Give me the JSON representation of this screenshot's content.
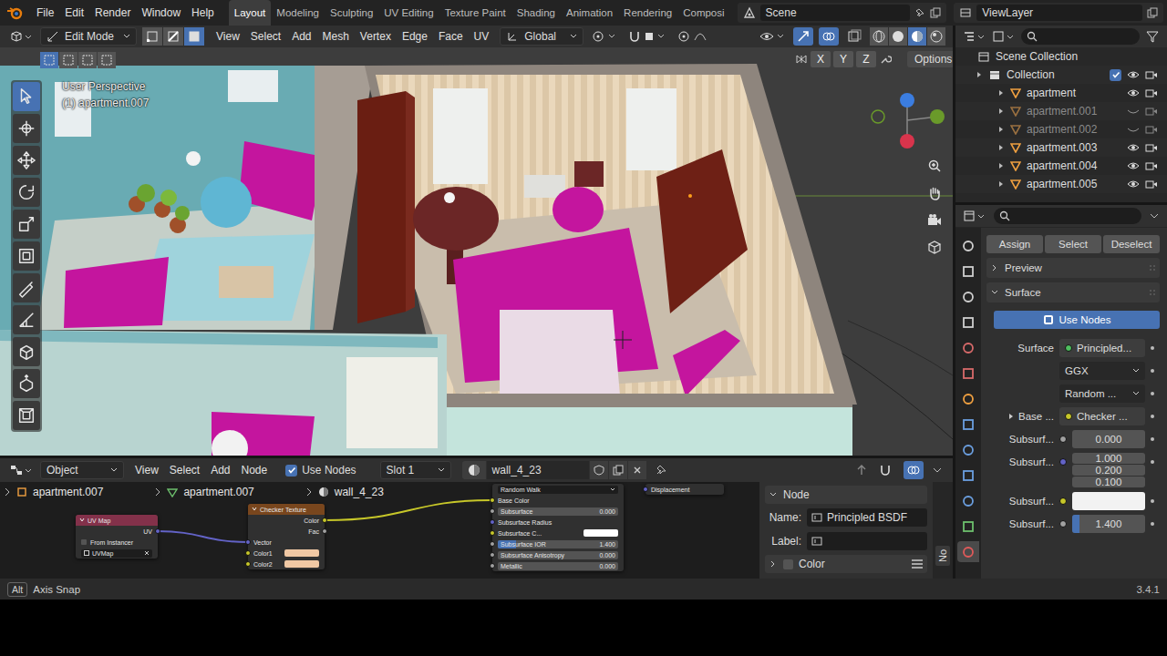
{
  "topbar": {
    "menus": [
      "File",
      "Edit",
      "Render",
      "Window",
      "Help"
    ],
    "workspaces": [
      {
        "label": "Layout",
        "selected": true
      },
      {
        "label": "Modeling",
        "selected": false
      },
      {
        "label": "Sculpting",
        "selected": false
      },
      {
        "label": "UV Editing",
        "selected": false
      },
      {
        "label": "Texture Paint",
        "selected": false
      },
      {
        "label": "Shading",
        "selected": false
      },
      {
        "label": "Animation",
        "selected": false
      },
      {
        "label": "Rendering",
        "selected": false
      },
      {
        "label": "Composi",
        "selected": false
      }
    ],
    "scene": "Scene",
    "view_layer": "ViewLayer"
  },
  "viewport_header": {
    "mode": "Edit Mode",
    "select_modes": [
      {
        "selected": false
      },
      {
        "selected": false
      },
      {
        "selected": true
      }
    ],
    "menus": [
      "View",
      "Select",
      "Add",
      "Mesh",
      "Vertex",
      "Edge",
      "Face",
      "UV"
    ],
    "orientation": "Global",
    "axes": [
      {
        "label": "X",
        "selected": false
      },
      {
        "label": "Y",
        "selected": false
      },
      {
        "label": "Z",
        "selected": false
      }
    ],
    "options": "Options"
  },
  "viewport": {
    "view_name": "User Perspective",
    "object_label": "(1) apartment.007",
    "box_modes": [
      {
        "selected": true
      },
      {
        "selected": false
      },
      {
        "selected": false
      },
      {
        "selected": false
      }
    ],
    "tools": [
      {
        "selected": true
      },
      {
        "selected": false
      },
      {
        "selected": false
      },
      {
        "selected": false
      },
      {
        "selected": false
      },
      {
        "selected": false
      },
      {
        "selected": false
      },
      {
        "selected": false
      },
      {
        "selected": false
      },
      {
        "selected": false
      },
      {
        "selected": false
      }
    ]
  },
  "outliner": {
    "root": "Scene Collection",
    "collection": {
      "label": "Collection",
      "checked": true
    },
    "items": [
      {
        "label": "apartment",
        "visible": true
      },
      {
        "label": "apartment.001",
        "visible": false
      },
      {
        "label": "apartment.002",
        "visible": false
      },
      {
        "label": "apartment.003",
        "visible": true
      },
      {
        "label": "apartment.004",
        "visible": true
      },
      {
        "label": "apartment.005",
        "visible": true
      }
    ]
  },
  "properties": {
    "tabs": [
      {
        "selected": false
      },
      {
        "selected": false
      },
      {
        "selected": false
      },
      {
        "selected": false
      },
      {
        "selected": false
      },
      {
        "selected": false
      },
      {
        "selected": false
      },
      {
        "selected": false
      },
      {
        "selected": false
      },
      {
        "selected": false
      },
      {
        "selected": false
      },
      {
        "selected": false
      },
      {
        "selected": true
      }
    ],
    "buttons": [
      "Assign",
      "Select",
      "Deselect"
    ],
    "panels": [
      {
        "label": "Preview",
        "expanded": false
      },
      {
        "label": "Surface",
        "expanded": true
      }
    ],
    "use_nodes": {
      "label": "Use Nodes",
      "on": true
    },
    "rows": [
      {
        "kind": "link",
        "label": "Surface",
        "value": "Principled...",
        "color": "#4fbf5f"
      },
      {
        "kind": "dropdown",
        "value": "GGX"
      },
      {
        "kind": "dropdown",
        "value": "Random ..."
      },
      {
        "kind": "link",
        "label": "Base ...",
        "value": "Checker ...",
        "color": "#c7c729",
        "expanded": false
      },
      {
        "kind": "number",
        "label": "Subsurf...",
        "value": "0.000",
        "color": "#a1a1a1",
        "level": 0
      },
      {
        "kind": "vector",
        "label": "Subsurf...",
        "values": [
          "1.000",
          "0.200",
          "0.100"
        ],
        "color": "#6363c7"
      },
      {
        "kind": "color",
        "label": "Subsurf...",
        "color": "#c7c729",
        "swatch": "#f2f2f2"
      },
      {
        "kind": "number",
        "label": "Subsurf...",
        "value": "1.400",
        "color": "#a1a1a1",
        "level": 0.1
      }
    ]
  },
  "node_editor": {
    "editor_type": "Object",
    "menus": [
      "View",
      "Select",
      "Add",
      "Node"
    ],
    "use_nodes": {
      "label": "Use Nodes",
      "checked": true
    },
    "slot": "Slot 1",
    "material": "wall_4_23",
    "breadcrumbs": [
      "apartment.007",
      "apartment.007",
      "wall_4_23"
    ],
    "nodes": [
      {
        "kind": "uv_map",
        "title": "UV Map",
        "color": "#83314a",
        "rows": [
          {
            "kind": "output",
            "label": "UV",
            "color": "#6363c7"
          },
          {
            "kind": "checkbox",
            "label": "From Instancer",
            "checked": false
          },
          {
            "kind": "field",
            "label": "UVMap"
          }
        ]
      },
      {
        "kind": "checker",
        "title": "Checker Texture",
        "color": "#79461d",
        "rows": [
          {
            "kind": "output",
            "label": "Color",
            "color": "#c7c729"
          },
          {
            "kind": "output",
            "label": "Fac",
            "color": "#a1a1a1"
          },
          {
            "kind": "input",
            "label": "Vector",
            "color": "#6363c7"
          },
          {
            "kind": "swatch",
            "label": "Color1",
            "color": "#c7c729",
            "swatch": "#f0c8a4"
          },
          {
            "kind": "swatch",
            "label": "Color2",
            "color": "#c7c729",
            "swatch": "#f0c8a4"
          }
        ]
      },
      {
        "kind": "principled",
        "rows": [
          {
            "kind": "dropdown",
            "label": "Random Walk"
          },
          {
            "kind": "input",
            "label": "Base Color",
            "color": "#c7c729"
          },
          {
            "kind": "number",
            "label": "Subsurface",
            "value": "0.000",
            "color": "#a1a1a1",
            "level": 0
          },
          {
            "kind": "input",
            "label": "Subsurface Radius",
            "color": "#6363c7"
          },
          {
            "kind": "swatch",
            "label": "Subsurface C...",
            "color": "#c7c729",
            "swatch": "#ffffff"
          },
          {
            "kind": "number",
            "label": "Subsurface IOR",
            "value": "1.400",
            "color": "#a1a1a1",
            "level": 0.15
          },
          {
            "kind": "number",
            "label": "Subsurface Anisotropy",
            "value": "0.000",
            "color": "#a1a1a1",
            "level": 0
          },
          {
            "kind": "number",
            "label": "Metallic",
            "value": "0.000",
            "color": "#a1a1a1",
            "level": 0
          }
        ]
      },
      {
        "kind": "output",
        "rows": [
          {
            "kind": "input",
            "label": "Displacement",
            "color": "#6363c7"
          }
        ]
      }
    ],
    "links": [
      {
        "color": "#6363c7"
      },
      {
        "color": "#c7c729"
      }
    ],
    "sidebar": {
      "section": {
        "label": "Node",
        "expanded": true
      },
      "name_label": "Name:",
      "name": "Principled BSDF",
      "label_label": "Label:",
      "subsection": {
        "label": "Color",
        "expanded": false,
        "checked": false
      },
      "tab": "No"
    }
  },
  "status_bar": {
    "key": "Alt",
    "hint": "Axis Snap",
    "version": "3.4.1"
  }
}
